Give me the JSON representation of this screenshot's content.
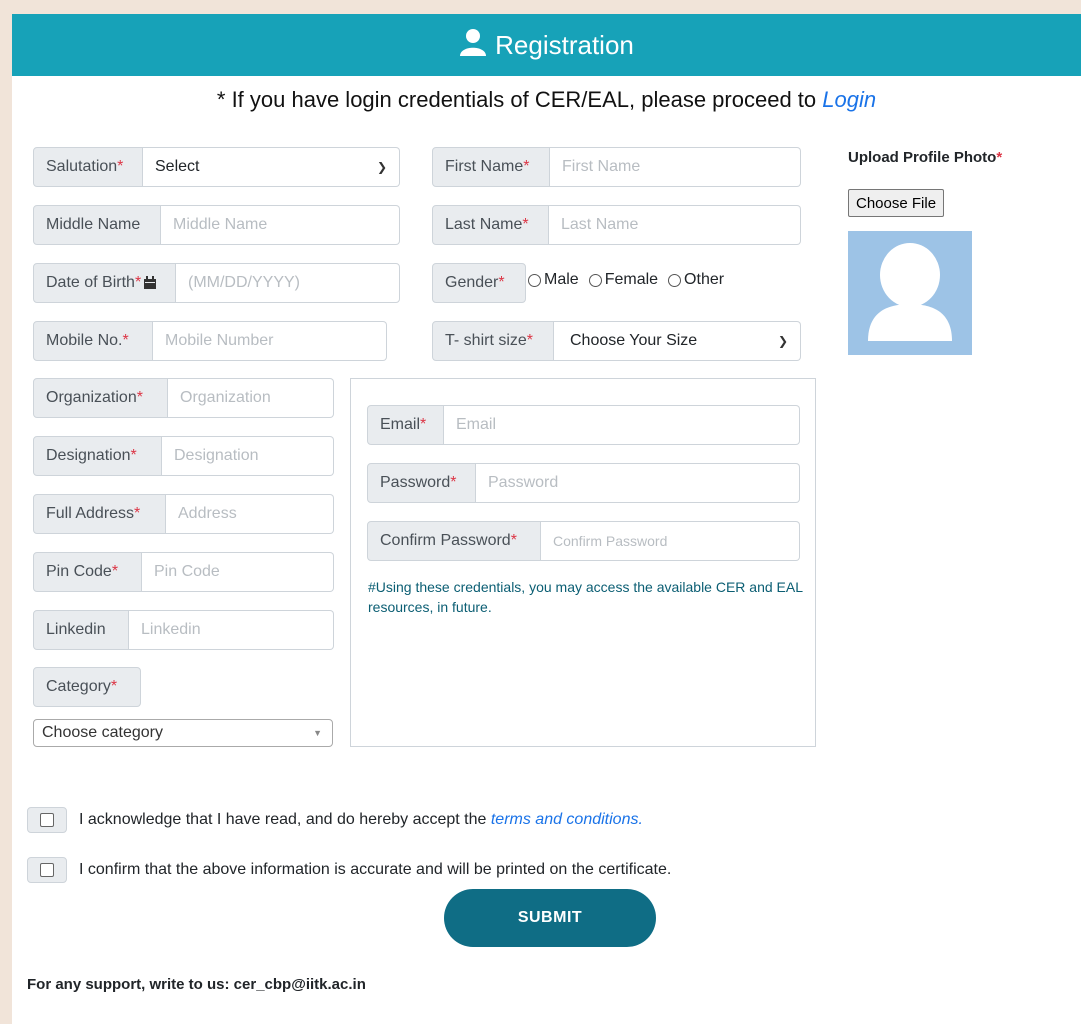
{
  "header": {
    "title": "Registration",
    "icon": "user-icon"
  },
  "notice": {
    "text": "* If you have login credentials of CER/EAL, please proceed to ",
    "link": "Login"
  },
  "form": {
    "salutation": {
      "label": "Salutation",
      "value": "Select"
    },
    "first_name": {
      "label": "First Name",
      "placeholder": "First Name"
    },
    "middle_name": {
      "label": "Middle Name",
      "placeholder": "Middle Name"
    },
    "last_name": {
      "label": "Last Name",
      "placeholder": "Last Name"
    },
    "dob": {
      "label": "Date of Birth",
      "placeholder": "(MM/DD/YYYY)",
      "icon": "calendar-icon"
    },
    "gender": {
      "label": "Gender",
      "options": [
        "Male",
        "Female",
        "Other"
      ]
    },
    "mobile": {
      "label": "Mobile No.",
      "placeholder": "Mobile Number"
    },
    "tshirt": {
      "label": "T- shirt size",
      "value": "Choose Your Size"
    },
    "organization": {
      "label": "Organization",
      "placeholder": "Organization"
    },
    "designation": {
      "label": "Designation",
      "placeholder": "Designation"
    },
    "address": {
      "label": "Full Address",
      "placeholder": "Address"
    },
    "pincode": {
      "label": "Pin Code",
      "placeholder": "Pin Code"
    },
    "linkedin": {
      "label": "Linkedin",
      "placeholder": "Linkedin"
    },
    "category": {
      "label": "Category",
      "value": "Choose category"
    },
    "email": {
      "label": "Email",
      "placeholder": "Email"
    },
    "password": {
      "label": "Password",
      "placeholder": "Password"
    },
    "confirm_password": {
      "label": "Confirm Password",
      "placeholder": "Confirm Password"
    },
    "cred_note": "#Using these credentials, you may access the available CER and EAL resources, in future.",
    "required_mark": "*"
  },
  "upload": {
    "title": "Upload Profile Photo",
    "button": "Choose File"
  },
  "checks": {
    "terms_text": "I acknowledge that I have read, and do hereby accept the ",
    "terms_link": "terms and conditions.",
    "confirm_text": "I confirm that the above information is accurate and will be printed on the certificate."
  },
  "submit": "SUBMIT",
  "support": "For any support, write to us: cer_cbp@iitk.ac.in",
  "colors": {
    "header": "#17a2b8",
    "submit": "#0f6d85",
    "link": "#1a73e8",
    "required": "#dc3545"
  }
}
